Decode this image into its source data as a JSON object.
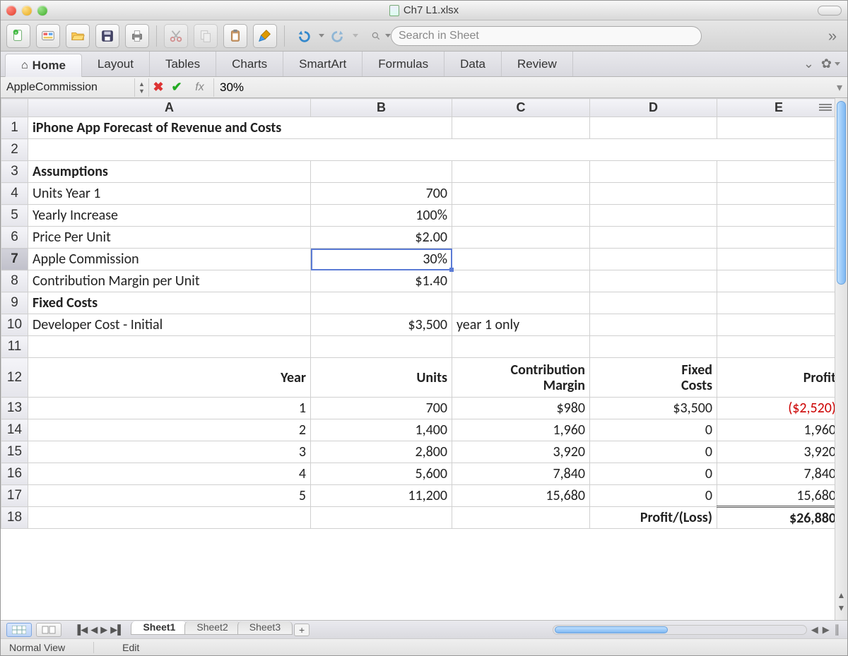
{
  "window": {
    "filename": "Ch7 L1.xlsx"
  },
  "toolbar": {
    "search_placeholder": "Search in Sheet"
  },
  "ribbon": {
    "tabs": [
      "Home",
      "Layout",
      "Tables",
      "Charts",
      "SmartArt",
      "Formulas",
      "Data",
      "Review"
    ],
    "active": 0
  },
  "formula_bar": {
    "name_box": "AppleCommission",
    "fx_label": "fx",
    "formula": "30%"
  },
  "columns": [
    "A",
    "B",
    "C",
    "D",
    "E"
  ],
  "row_headers": [
    "1",
    "2",
    "3",
    "4",
    "5",
    "6",
    "7",
    "8",
    "9",
    "10",
    "11",
    "12",
    "13",
    "14",
    "15",
    "16",
    "17",
    "18"
  ],
  "selected_row_header": "7",
  "cells": {
    "A1": "iPhone App Forecast of Revenue and Costs",
    "A3": "Assumptions",
    "A4": "Units Year 1",
    "B4": "700",
    "A5": "Yearly Increase",
    "B5": "100%",
    "A6": "Price Per Unit",
    "B6": "$2.00",
    "A7": "Apple Commission",
    "B7": "30%",
    "A8": "Contribution Margin per Unit",
    "B8": "$1.40",
    "A9": "Fixed  Costs",
    "A10": "Developer Cost - Initial",
    "B10": "$3,500",
    "C10": "year 1 only",
    "A12": "Year",
    "B12": "Units",
    "C12a": "Contribution",
    "C12b": "Margin",
    "D12a": "Fixed",
    "D12b": "Costs",
    "E12": "Profit",
    "A13": "1",
    "B13": "700",
    "C13": "$980",
    "D13": "$3,500",
    "E13": "($2,520)",
    "A14": "2",
    "B14": "1,400",
    "C14": "1,960",
    "D14": "0",
    "E14": "1,960",
    "A15": "3",
    "B15": "2,800",
    "C15": "3,920",
    "D15": "0",
    "E15": "3,920",
    "A16": "4",
    "B16": "5,600",
    "C16": "7,840",
    "D16": "0",
    "E16": "7,840",
    "A17": "5",
    "B17": "11,200",
    "C17": "15,680",
    "D17": "0",
    "E17": "15,680",
    "D18": "Profit/(Loss)",
    "E18": "$26,880"
  },
  "sheet_tabs": {
    "tabs": [
      "Sheet1",
      "Sheet2",
      "Sheet3"
    ],
    "active": 0
  },
  "status": {
    "view_label": "Normal View",
    "mode": "Edit"
  },
  "chart_data": {
    "type": "table",
    "title": "iPhone App Forecast of Revenue and Costs",
    "assumptions": {
      "units_year_1": 700,
      "yearly_increase_pct": 100,
      "price_per_unit_usd": 2.0,
      "apple_commission_pct": 30,
      "contribution_margin_per_unit_usd": 1.4
    },
    "fixed_costs": {
      "developer_cost_initial_usd": 3500,
      "note": "year 1 only"
    },
    "columns": [
      "Year",
      "Units",
      "Contribution Margin",
      "Fixed Costs",
      "Profit"
    ],
    "rows": [
      {
        "year": 1,
        "units": 700,
        "contribution_margin": 980,
        "fixed_costs": 3500,
        "profit": -2520
      },
      {
        "year": 2,
        "units": 1400,
        "contribution_margin": 1960,
        "fixed_costs": 0,
        "profit": 1960
      },
      {
        "year": 3,
        "units": 2800,
        "contribution_margin": 3920,
        "fixed_costs": 0,
        "profit": 3920
      },
      {
        "year": 4,
        "units": 5600,
        "contribution_margin": 7840,
        "fixed_costs": 0,
        "profit": 7840
      },
      {
        "year": 5,
        "units": 11200,
        "contribution_margin": 15680,
        "fixed_costs": 0,
        "profit": 15680
      }
    ],
    "total_profit": 26880
  }
}
